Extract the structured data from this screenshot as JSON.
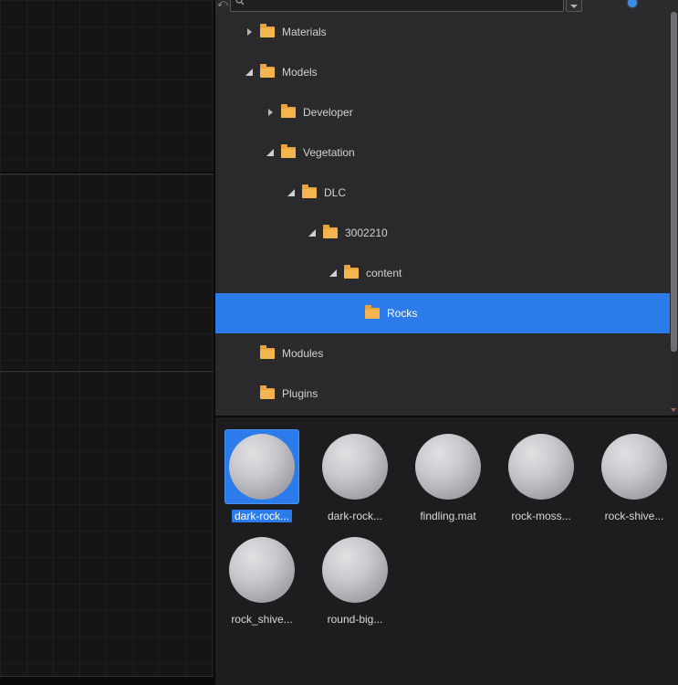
{
  "colors": {
    "accent_blue": "#2b7bea",
    "folder_amber": "#e9a43d",
    "panel_dark": "#2a2a2c"
  },
  "toolbar": {
    "search_value": "",
    "search_placeholder": ""
  },
  "tree": {
    "items": [
      {
        "label": "Materials",
        "level": 0,
        "state": "collapsed",
        "selected": false
      },
      {
        "label": "Models",
        "level": 0,
        "state": "expanded",
        "selected": false
      },
      {
        "label": "Developer",
        "level": 1,
        "state": "collapsed",
        "selected": false
      },
      {
        "label": "Vegetation",
        "level": 1,
        "state": "expanded",
        "selected": false
      },
      {
        "label": "DLC",
        "level": 2,
        "state": "expanded",
        "selected": false
      },
      {
        "label": "3002210",
        "level": 3,
        "state": "expanded",
        "selected": false
      },
      {
        "label": "content",
        "level": 4,
        "state": "expanded",
        "selected": false
      },
      {
        "label": "Rocks",
        "level": 5,
        "state": "none",
        "selected": true
      },
      {
        "label": "Modules",
        "level": 0,
        "state": "none",
        "selected": false
      },
      {
        "label": "Plugins",
        "level": 0,
        "state": "none",
        "selected": false
      }
    ]
  },
  "assets": {
    "items": [
      {
        "label": "dark-rock...",
        "selected": true
      },
      {
        "label": "dark-rock...",
        "selected": false
      },
      {
        "label": "findling.mat",
        "selected": false
      },
      {
        "label": "rock-moss...",
        "selected": false
      },
      {
        "label": "rock-shive...",
        "selected": false
      },
      {
        "label": "rock_shive...",
        "selected": false
      },
      {
        "label": "round-big...",
        "selected": false
      }
    ]
  }
}
